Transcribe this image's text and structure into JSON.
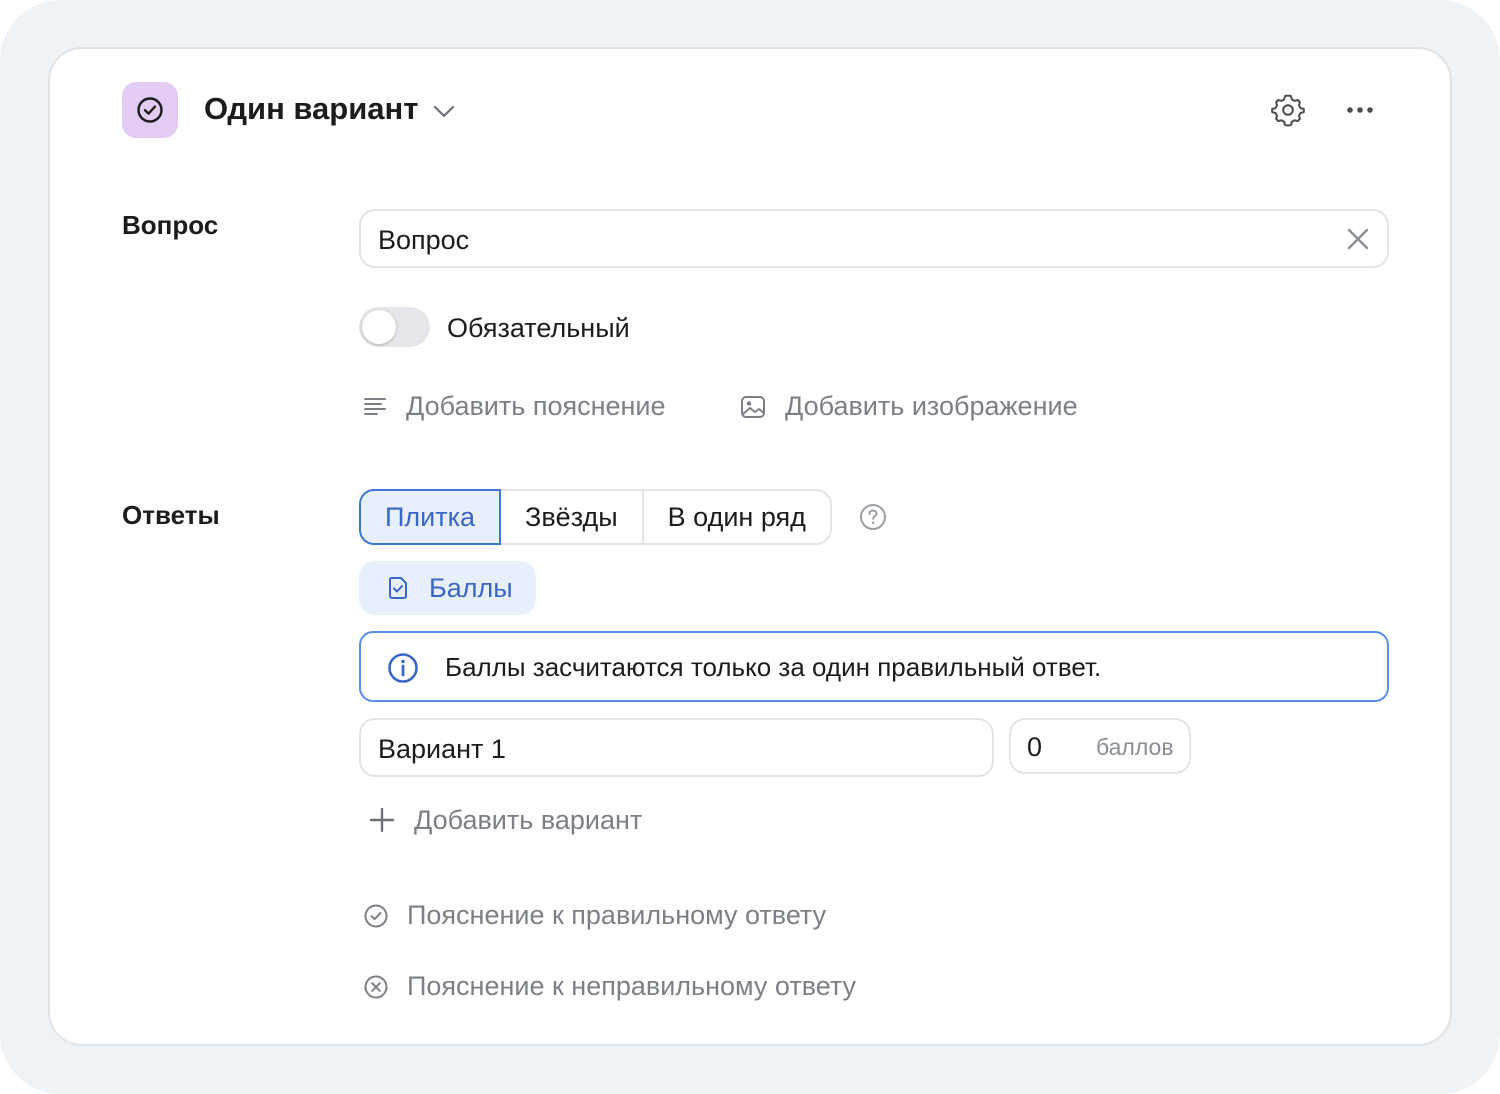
{
  "header": {
    "question_type": "Один вариант"
  },
  "question": {
    "section_label": "Вопрос",
    "input_value": "Вопрос",
    "required_label": "Обязательный",
    "required_on": false,
    "add_description": "Добавить пояснение",
    "add_image": "Добавить изображение"
  },
  "answers": {
    "section_label": "Ответы",
    "view_modes": [
      {
        "label": "Плитка",
        "active": true
      },
      {
        "label": "Звёзды",
        "active": false
      },
      {
        "label": "В один ряд",
        "active": false
      }
    ],
    "scores_chip": "Баллы",
    "info_text": "Баллы засчитаются только за один правильный ответ.",
    "options": [
      {
        "label": "Вариант 1",
        "score": "0",
        "score_unit": "баллов"
      }
    ],
    "add_option": "Добавить вариант",
    "correct_explanation": "Пояснение к правильному ответу",
    "incorrect_explanation": "Пояснение к неправильному ответу"
  },
  "colors": {
    "accent": "#3f74d9",
    "accent_bg": "#e6effb",
    "type_icon_bg": "#e3ccf3",
    "page_bg": "#eef3f8"
  },
  "icons": [
    "check-circle-icon",
    "chevron-down-icon",
    "gear-icon",
    "more-horizontal-icon",
    "close-icon",
    "text-lines-icon",
    "image-icon",
    "help-circle-icon",
    "check-square-icon",
    "info-icon",
    "plus-icon",
    "check-circle-outline-icon",
    "x-circle-icon"
  ]
}
